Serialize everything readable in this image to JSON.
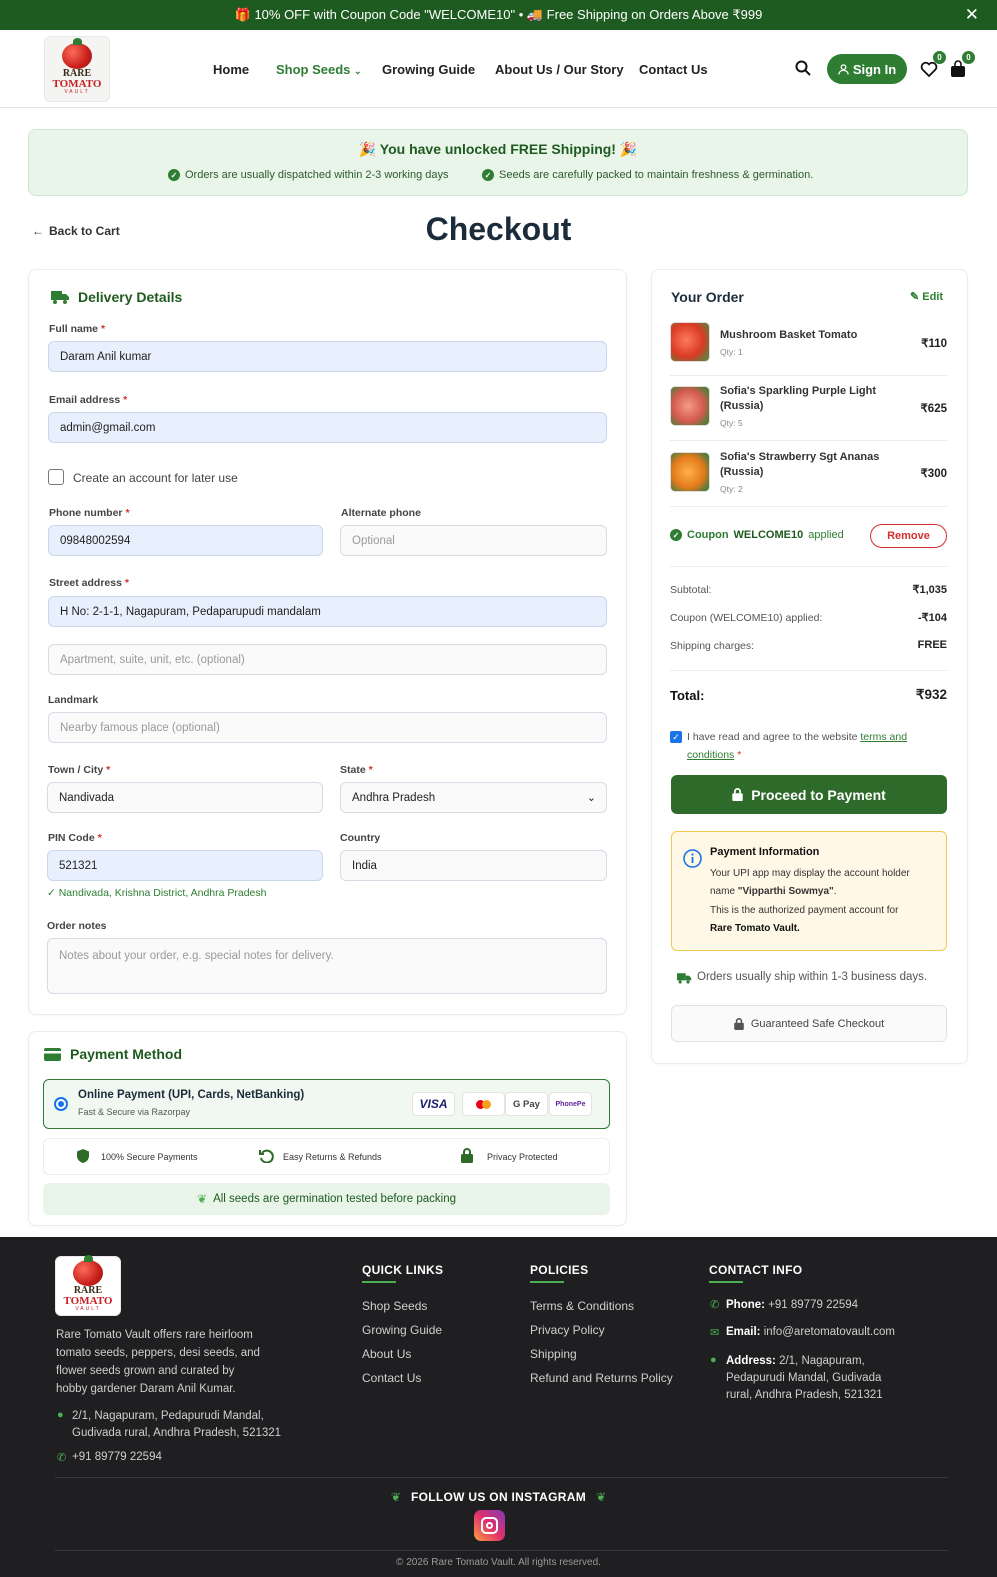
{
  "topbar": {
    "text": "🎁 10% OFF with Coupon Code \"WELCOME10\" • 🚚 Free Shipping on Orders Above ₹999",
    "close": "✕"
  },
  "logo": {
    "line1": "RARE",
    "line2": "TOMATO",
    "line3": "VAULT"
  },
  "nav": {
    "home": "Home",
    "shop": "Shop Seeds",
    "guide": "Growing Guide",
    "about": "About Us / Our Story",
    "contact": "Contact Us"
  },
  "header": {
    "signin": "Sign In",
    "wishlist_count": "0",
    "cart_count": "0"
  },
  "banner": {
    "title": "🎉 You have unlocked FREE Shipping! 🎉",
    "note1": "Orders are usually dispatched within 2-3 working days",
    "note2": "Seeds are carefully packed to maintain freshness & germination."
  },
  "page": {
    "back": "Back to Cart",
    "title": "Checkout"
  },
  "delivery": {
    "title": "Delivery Details",
    "full_name_label": "Full name",
    "full_name": "Daram Anil kumar",
    "email_label": "Email address",
    "email": "admin@gmail.com",
    "create_account": "Create an account for later use",
    "phone_label": "Phone number",
    "phone": "09848002594",
    "alt_phone_label": "Alternate phone",
    "alt_phone_ph": "Optional",
    "street_label": "Street address",
    "street": "H No: 2-1-1, Nagapuram, Pedaparupudi mandalam",
    "apt_ph": "Apartment, suite, unit, etc. (optional)",
    "landmark_label": "Landmark",
    "landmark_ph": "Nearby famous place (optional)",
    "town_label": "Town / City",
    "town": "Nandivada",
    "state_label": "State",
    "state": "Andhra Pradesh",
    "pin_label": "PIN Code",
    "pin": "521321",
    "country_label": "Country",
    "country": "India",
    "pin_hint": "✓ Nandivada, Krishna District, Andhra Pradesh",
    "notes_label": "Order notes",
    "notes_ph": "Notes about your order, e.g. special notes for delivery."
  },
  "payment": {
    "title": "Payment Method",
    "option": "Online Payment (UPI, Cards, NetBanking)",
    "option_sub": "Fast & Secure via Razorpay",
    "logos": [
      "VISA",
      "●●",
      "G Pay",
      "PhonePe"
    ],
    "trust1": "100% Secure Payments",
    "trust2": "Easy Returns & Refunds",
    "trust3": "Privacy Protected",
    "germ": "All seeds are germination tested before packing"
  },
  "order": {
    "title": "Your Order",
    "edit": "Edit",
    "items": [
      {
        "name": "Mushroom Basket Tomato",
        "qty": "Qty: 1",
        "price": "₹110"
      },
      {
        "name": "Sofia's Sparkling Purple Light (Russia)",
        "qty": "Qty: 5",
        "price": "₹625"
      },
      {
        "name": "Sofia's Strawberry Sgt Ananas (Russia)",
        "qty": "Qty: 2",
        "price": "₹300"
      }
    ],
    "coupon_prefix": "Coupon",
    "coupon_code": "WELCOME10",
    "coupon_suffix": "applied",
    "remove": "Remove",
    "subtotal_label": "Subtotal:",
    "subtotal": "₹1,035",
    "discount_label": "Coupon (WELCOME10) applied:",
    "discount": "-₹104",
    "shipping_label": "Shipping charges:",
    "shipping": "FREE",
    "total_label": "Total:",
    "total": "₹932",
    "terms_pre": "I have read and agree to the website ",
    "terms_link1": "terms and",
    "terms_link2": "conditions",
    "proceed": "Proceed to Payment",
    "info_title": "Payment Information",
    "info_l1": "Your UPI app may display the account holder",
    "info_l2a": "name ",
    "info_l2b": "\"Vipparthi Sowmya\"",
    "info_l3": "This is the authorized payment account for",
    "info_l4": "Rare Tomato Vault.",
    "ship_note": "Orders usually ship within 1-3 business days.",
    "safe": "Guaranteed Safe Checkout"
  },
  "footer": {
    "about1": "Rare Tomato Vault offers rare heirloom",
    "about2": "tomato seeds, peppers, desi seeds, and",
    "about3": "flower seeds grown and curated by",
    "about4": "hobby gardener Daram Anil Kumar.",
    "addr1": "2/1, Nagapuram, Pedapurudi Mandal,",
    "addr2": "Gudivada rural, Andhra Pradesh, 521321",
    "phone": "+91 89779 22594",
    "quick_title": "QUICK LINKS",
    "quick": [
      "Shop Seeds",
      "Growing Guide",
      "About Us",
      "Contact Us"
    ],
    "policies_title": "POLICIES",
    "policies": [
      "Terms & Conditions",
      "Privacy Policy",
      "Shipping",
      "Refund and Returns Policy"
    ],
    "contact_title": "CONTACT INFO",
    "c_phone_label": "Phone:",
    "c_phone": "+91 89779 22594",
    "c_email_label": "Email:",
    "c_email": "info@aretomatovault.com",
    "c_addr_label": "Address:",
    "c_addr1": "2/1, Nagapuram,",
    "c_addr2": "Pedapurudi Mandal, Gudivada",
    "c_addr3": "rural, Andhra Pradesh, 521321",
    "follow": "FOLLOW US ON INSTAGRAM",
    "copyright": "© 2026 Rare Tomato Vault. All rights reserved."
  },
  "colors": {
    "brand": "#2e7d32",
    "dark": "#1e5b20",
    "footer": "#1f1f21"
  }
}
